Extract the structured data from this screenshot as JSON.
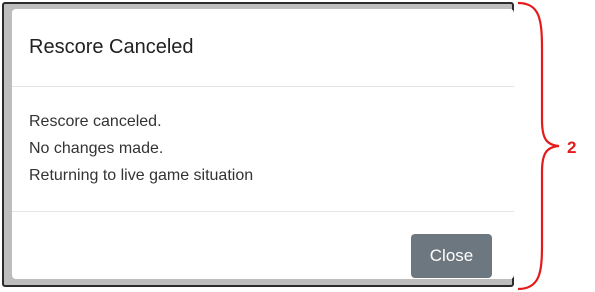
{
  "dialog": {
    "title": "Rescore Canceled",
    "body_lines": [
      "Rescore canceled.",
      "No changes made.",
      "Returning to live game situation"
    ],
    "close_label": "Close"
  },
  "annotation": {
    "label": "2",
    "color": "#e31b1b"
  },
  "colors": {
    "close_button_bg": "#6c7780",
    "backdrop": "#bdbdbd"
  }
}
